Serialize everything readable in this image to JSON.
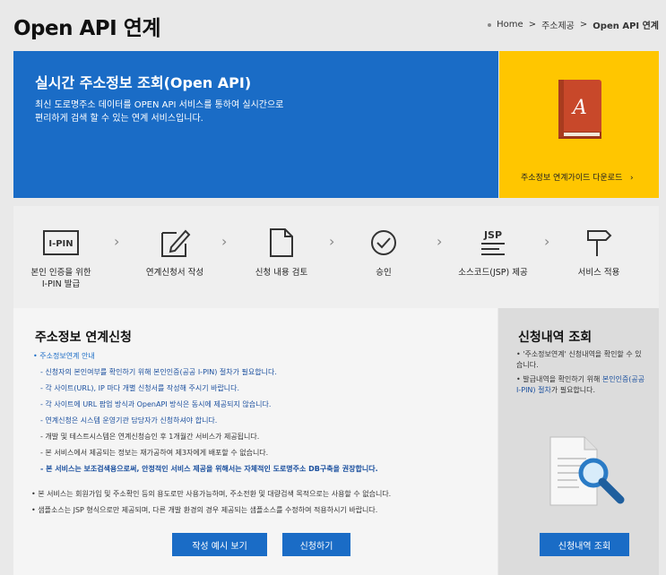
{
  "header": {
    "title": "Open API 연계",
    "breadcrumb": [
      "Home",
      "주소제공",
      "Open API 연계"
    ]
  },
  "banner": {
    "title": "실시간 주소정보 조회(Open API)",
    "desc_line1": "최신 도로명주소 데이터를 OPEN API 서비스를 통하여 실시간으로",
    "desc_line2": "편리하게 검색 할 수 있는 연계 서비스입니다.",
    "guide_link": "주소정보 연계가이드 다운로드",
    "book_letters": "A"
  },
  "colors": {
    "accent": "#1a6cc6",
    "guide_bg": "#ffc600",
    "book": "#c8482a"
  },
  "steps": [
    {
      "icon": "ipin-icon",
      "icon_text": "I-PIN",
      "label1": "본인 인증을 위한",
      "label2": "I-PIN 발급"
    },
    {
      "icon": "edit-icon",
      "label1": "연계신청서 작성",
      "label2": ""
    },
    {
      "icon": "document-icon",
      "label1": "신청 내용 검토",
      "label2": ""
    },
    {
      "icon": "check-circle-icon",
      "label1": "승인",
      "label2": ""
    },
    {
      "icon": "jsp-icon",
      "icon_text": "JSP",
      "label1": "소스코드(JSP) 제공",
      "label2": ""
    },
    {
      "icon": "signpost-icon",
      "label1": "서비스 적용",
      "label2": ""
    }
  ],
  "apply": {
    "title": "주소정보 연계신청",
    "section": "• 주소정보연계 안내",
    "guide": [
      "- 신청자의 본인여부를 확인하기 위해 본인인증(공공 I-PIN) 절차가 필요합니다.",
      "- 각 사이트(URL), IP 마다 개별 신청서를 작성해 주시기 바랍니다.",
      "- 각 사이트에 URL 팝업 방식과 OpenAPI 방식은 동시에 제공되지 않습니다.",
      "- 연계신청은 시스템 운영기관 담당자가 신청하셔야 합니다.",
      "- 개발 및 테스트시스템은 연계신청승인 후 1개월간 서비스가 제공됩니다.",
      "- 본 서비스에서 제공되는 정보는 재가공하여 제3자에게 배포할 수 없습니다.",
      "- 본 서비스는 보조검색용으로써, 안정적인 서비스 제공을 위해서는 자체적인 도로명주소 DB구축을 권장합니다."
    ],
    "notes": [
      "• 본 서비스는 회원가입 및 주소확인 등의 용도로만 사용가능하며, 주소전환 및 대량검색 목적으로는 사용할 수 없습니다.",
      "• 샘플소스는 JSP 형식으로만 제공되며, 다른 개발 환경의 경우 제공되는 샘플소스를 수정하여 적용하시기 바랍니다."
    ],
    "btn_example": "작성 예시 보기",
    "btn_apply": "신청하기"
  },
  "lookup": {
    "title": "신청내역 조회",
    "note1": "• '주소정보연계' 신청내역을 확인할 수 있습니다.",
    "note2_pre": "• 발급내역을 확인하기 위해 ",
    "note2_hl": "본인인증(공공 I-PIN) 절차",
    "note2_post": "가 필요합니다.",
    "button": "신청내역 조회"
  }
}
